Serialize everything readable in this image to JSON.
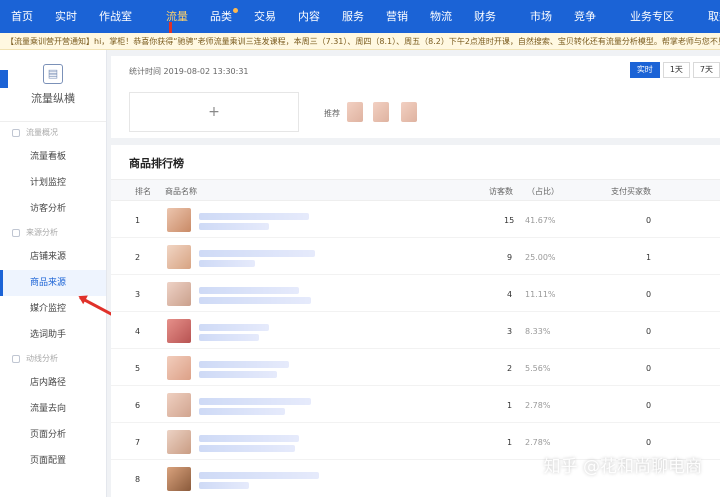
{
  "nav": {
    "items": [
      "首页",
      "实时",
      "作战室",
      "流量",
      "品类",
      "交易",
      "内容",
      "服务",
      "营销",
      "物流",
      "财务",
      "市场",
      "竞争",
      "业务专区",
      "取数"
    ],
    "active_index": 3,
    "accent": "#1b63d6"
  },
  "notice": "【流量乘训营开营通知】hi，掌柜！恭喜你获得“驰骋”老师流量乘训三连发课程，本周三（7.31）、周四（8.1）、周五（8.2）下午2点准时开课，自然搜索、宝贝转化还有流量分析模型。帮掌老师与您不见不散！",
  "sidebar": {
    "title": "流量纵横",
    "groups": [
      {
        "label": "流量概况",
        "items": [
          "流量看板",
          "计划监控",
          "访客分析"
        ]
      },
      {
        "label": "来源分析",
        "items": [
          "店铺来源",
          "商品来源",
          "媒介监控",
          "选词助手"
        ]
      },
      {
        "label": "动线分析",
        "items": [
          "店内路径",
          "流量去向",
          "页面分析",
          "页面配置"
        ]
      }
    ],
    "active_item": "商品来源"
  },
  "top_card": {
    "stat_time": "统计时间 2019-08-02 13:30:31",
    "add_symbol": "+",
    "recommend_label": "推荐",
    "time_buttons": [
      "实时",
      "1天",
      "7天"
    ]
  },
  "rank": {
    "title": "商品排行榜",
    "headers": {
      "rank": "排名",
      "name": "商品名称",
      "visitors": "访客数",
      "ratio": "（占比）",
      "buyers": "支付买家数"
    },
    "rows": [
      {
        "rank": "1",
        "visitors": "15",
        "ratio": "41.67%",
        "buyers": "0"
      },
      {
        "rank": "2",
        "visitors": "9",
        "ratio": "25.00%",
        "buyers": "1"
      },
      {
        "rank": "3",
        "visitors": "4",
        "ratio": "11.11%",
        "buyers": "0"
      },
      {
        "rank": "4",
        "visitors": "3",
        "ratio": "8.33%",
        "buyers": "0"
      },
      {
        "rank": "5",
        "visitors": "2",
        "ratio": "5.56%",
        "buyers": "0"
      },
      {
        "rank": "6",
        "visitors": "1",
        "ratio": "2.78%",
        "buyers": "0"
      },
      {
        "rank": "7",
        "visitors": "1",
        "ratio": "2.78%",
        "buyers": "0"
      },
      {
        "rank": "8",
        "visitors": "",
        "ratio": "",
        "buyers": ""
      }
    ]
  },
  "watermark": "知乎 @花和尚聊电商"
}
